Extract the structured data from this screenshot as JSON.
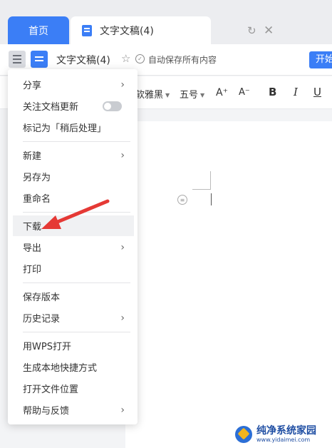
{
  "tabs": {
    "home": "首页",
    "doc": "文字文稿(4)"
  },
  "titlebar": {
    "doc_name": "文字文稿(4)",
    "autosave": "自动保存所有内容",
    "start": "开始"
  },
  "toolbar": {
    "font": "软雅黑",
    "size": "五号",
    "grow": "A⁺",
    "shrink": "A⁻",
    "bold": "B",
    "italic": "I",
    "underline": "U"
  },
  "menu": {
    "share": "分享",
    "follow": "关注文档更新",
    "mark_later": "标记为「稍后处理」",
    "new": "新建",
    "save_as": "另存为",
    "rename": "重命名",
    "download": "下载",
    "export": "导出",
    "print": "打印",
    "save_version": "保存版本",
    "history": "历史记录",
    "open_wps": "用WPS打开",
    "shortcut": "生成本地快捷方式",
    "open_location": "打开文件位置",
    "help": "帮助与反馈"
  },
  "watermark": {
    "name": "纯净系统家园",
    "url": "www.yidaimei.com"
  },
  "colors": {
    "accent": "#3b7ef6",
    "annotation": "#e53935"
  }
}
